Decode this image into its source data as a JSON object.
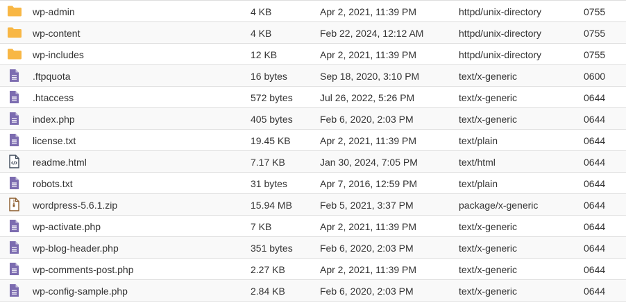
{
  "colors": {
    "folder": "#f8b745",
    "doc": "#7c6cb0",
    "html_icon": "#3f4a5a",
    "zip": "#8a5a2b",
    "row_alt": "#f9f9f9",
    "border": "#dddddd"
  },
  "files": [
    {
      "icon": "folder-icon",
      "name": "wp-admin",
      "size": "4 KB",
      "modified": "Apr 2, 2021, 11:39 PM",
      "type": "httpd/unix-directory",
      "perms": "0755"
    },
    {
      "icon": "folder-icon",
      "name": "wp-content",
      "size": "4 KB",
      "modified": "Feb 22, 2024, 12:12 AM",
      "type": "httpd/unix-directory",
      "perms": "0755"
    },
    {
      "icon": "folder-icon",
      "name": "wp-includes",
      "size": "12 KB",
      "modified": "Apr 2, 2021, 11:39 PM",
      "type": "httpd/unix-directory",
      "perms": "0755"
    },
    {
      "icon": "file-text-icon",
      "name": ".ftpquota",
      "size": "16 bytes",
      "modified": "Sep 18, 2020, 3:10 PM",
      "type": "text/x-generic",
      "perms": "0600"
    },
    {
      "icon": "file-text-icon",
      "name": ".htaccess",
      "size": "572 bytes",
      "modified": "Jul 26, 2022, 5:26 PM",
      "type": "text/x-generic",
      "perms": "0644"
    },
    {
      "icon": "file-text-icon",
      "name": "index.php",
      "size": "405 bytes",
      "modified": "Feb 6, 2020, 2:03 PM",
      "type": "text/x-generic",
      "perms": "0644"
    },
    {
      "icon": "file-text-icon",
      "name": "license.txt",
      "size": "19.45 KB",
      "modified": "Apr 2, 2021, 11:39 PM",
      "type": "text/plain",
      "perms": "0644"
    },
    {
      "icon": "file-code-icon",
      "name": "readme.html",
      "size": "7.17 KB",
      "modified": "Jan 30, 2024, 7:05 PM",
      "type": "text/html",
      "perms": "0644"
    },
    {
      "icon": "file-text-icon",
      "name": "robots.txt",
      "size": "31 bytes",
      "modified": "Apr 7, 2016, 12:59 PM",
      "type": "text/plain",
      "perms": "0644"
    },
    {
      "icon": "file-zip-icon",
      "name": "wordpress-5.6.1.zip",
      "size": "15.94 MB",
      "modified": "Feb 5, 2021, 3:37 PM",
      "type": "package/x-generic",
      "perms": "0644"
    },
    {
      "icon": "file-text-icon",
      "name": "wp-activate.php",
      "size": "7 KB",
      "modified": "Apr 2, 2021, 11:39 PM",
      "type": "text/x-generic",
      "perms": "0644"
    },
    {
      "icon": "file-text-icon",
      "name": "wp-blog-header.php",
      "size": "351 bytes",
      "modified": "Feb 6, 2020, 2:03 PM",
      "type": "text/x-generic",
      "perms": "0644"
    },
    {
      "icon": "file-text-icon",
      "name": "wp-comments-post.php",
      "size": "2.27 KB",
      "modified": "Apr 2, 2021, 11:39 PM",
      "type": "text/x-generic",
      "perms": "0644"
    },
    {
      "icon": "file-text-icon",
      "name": "wp-config-sample.php",
      "size": "2.84 KB",
      "modified": "Feb 6, 2020, 2:03 PM",
      "type": "text/x-generic",
      "perms": "0644"
    }
  ]
}
